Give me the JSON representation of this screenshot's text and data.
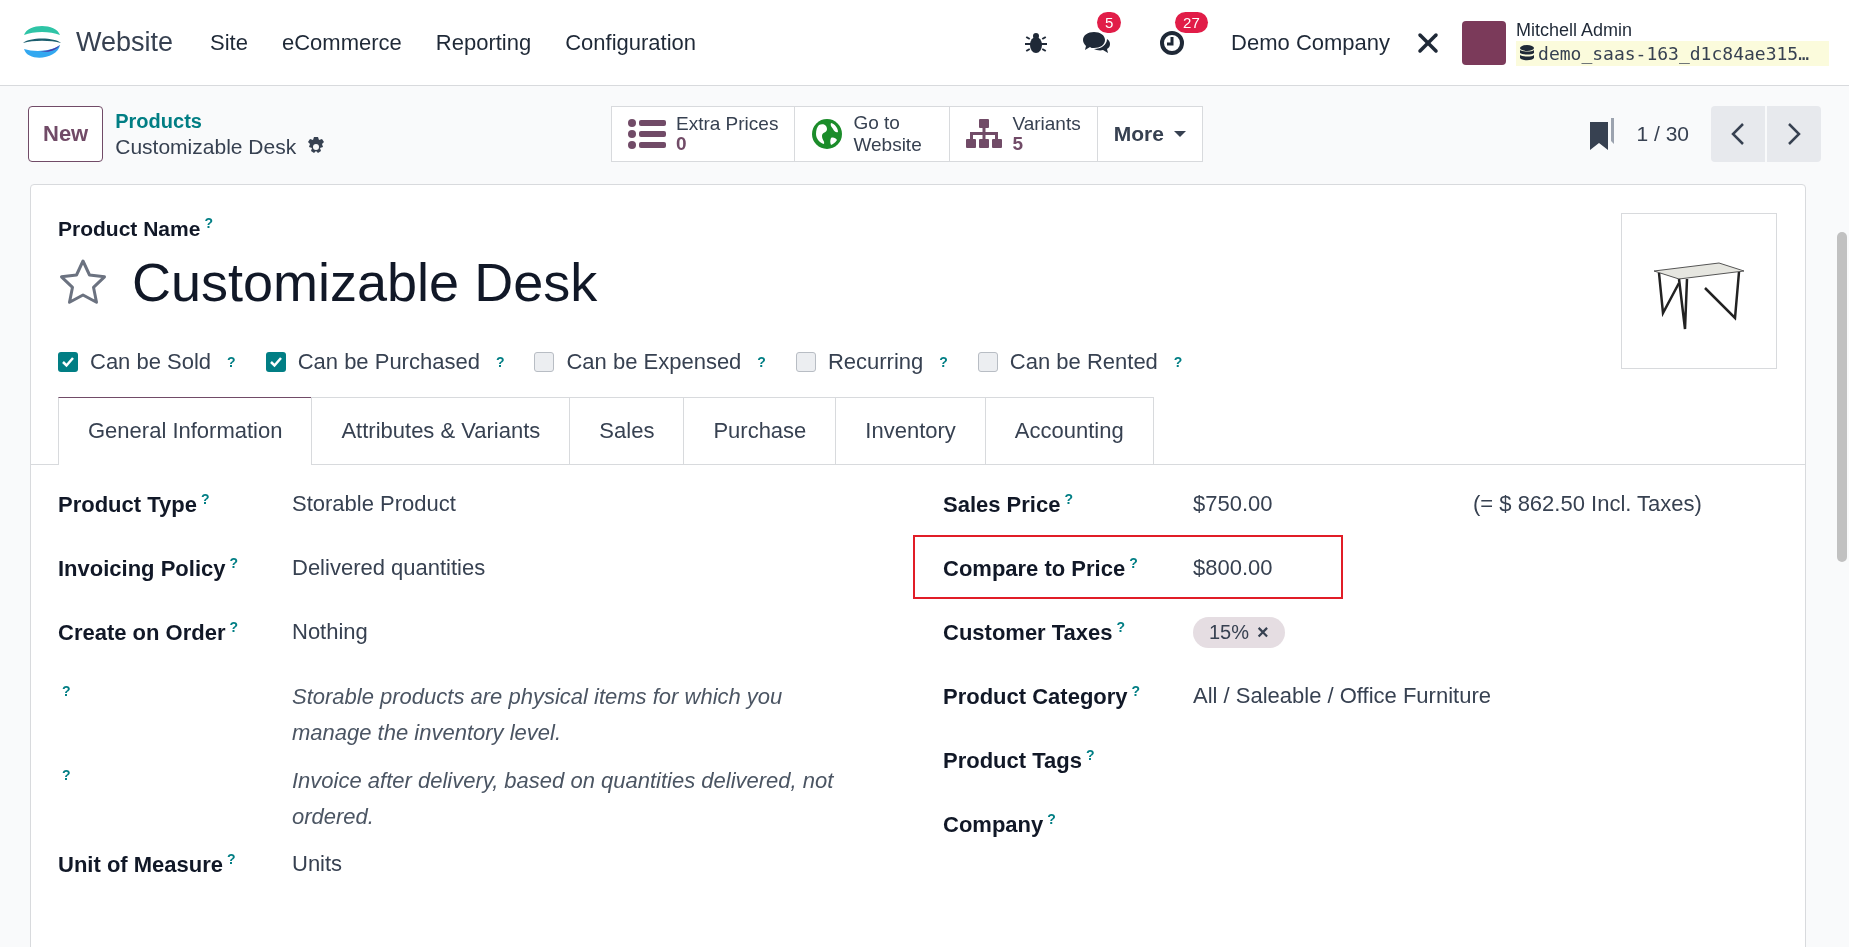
{
  "navbar": {
    "app_name": "Website",
    "menu": [
      "Site",
      "eCommerce",
      "Reporting",
      "Configuration"
    ],
    "messages_count": "5",
    "activities_count": "27",
    "company": "Demo Company",
    "user_name": "Mitchell Admin",
    "database": "demo_saas-163_d1c84ae315…"
  },
  "control_panel": {
    "new_button": "New",
    "breadcrumb": "Products",
    "record_name": "Customizable Desk",
    "pager": "1 / 30",
    "smart_buttons": [
      {
        "kind": "stat",
        "label": "Extra Prices",
        "value": "0"
      },
      {
        "kind": "text",
        "label": "Go to Website"
      },
      {
        "kind": "stat",
        "label": "Variants",
        "value": "5"
      },
      {
        "kind": "dropdown",
        "label": "More"
      }
    ]
  },
  "form": {
    "name_label": "Product Name",
    "name_help": "?",
    "name": "Customizable Desk",
    "favorite": false,
    "options": [
      {
        "label": "Can be Sold",
        "help": "?",
        "checked": true
      },
      {
        "label": "Can be Purchased",
        "help": "?",
        "checked": true
      },
      {
        "label": "Can be Expensed",
        "help": "?",
        "checked": false
      },
      {
        "label": "Recurring",
        "help": "?",
        "checked": false
      },
      {
        "label": "Can be Rented",
        "help": "?",
        "checked": false
      }
    ],
    "tabs": [
      {
        "label": "General Information",
        "selected": true
      },
      {
        "label": "Attributes & Variants",
        "selected": false
      },
      {
        "label": "Sales",
        "selected": false
      },
      {
        "label": "Purchase",
        "selected": false
      },
      {
        "label": "Inventory",
        "selected": false
      },
      {
        "label": "Accounting",
        "selected": false
      }
    ],
    "left_fields": [
      {
        "kind": "field",
        "label": "Product Type",
        "help": "?",
        "value": "Storable Product"
      },
      {
        "kind": "field",
        "label": "Invoicing Policy",
        "help": "?",
        "value": "Delivered quantities"
      },
      {
        "kind": "field",
        "label": "Create on Order",
        "help": "?",
        "value": "Nothing"
      },
      {
        "kind": "note",
        "help": "?",
        "text": "Storable products are physical items for which you manage the inventory level."
      },
      {
        "kind": "note",
        "help": "?",
        "text": "Invoice after delivery, based on quantities delivered, not ordered."
      },
      {
        "kind": "field",
        "label": "Unit of Measure",
        "help": "?",
        "value": "Units"
      }
    ],
    "right_fields": [
      {
        "kind": "field",
        "label": "Sales Price",
        "help": "?",
        "value": "$750.00",
        "extra": "(= $ 862.50 Incl. Taxes)",
        "highlighted": false
      },
      {
        "kind": "field",
        "label": "Compare to Price",
        "help": "?",
        "value": "$800.00",
        "highlighted": true
      },
      {
        "kind": "tags",
        "label": "Customer Taxes",
        "help": "?",
        "tags": [
          {
            "label": "15%",
            "remove": "×"
          }
        ],
        "highlighted": false
      },
      {
        "kind": "field",
        "label": "Product Category",
        "help": "?",
        "value": "All / Saleable / Office Furniture",
        "highlighted": false
      },
      {
        "kind": "field",
        "label": "Product Tags",
        "help": "?",
        "highlighted": false
      },
      {
        "kind": "field",
        "label": "Company",
        "help": "?",
        "highlighted": false
      }
    ]
  }
}
